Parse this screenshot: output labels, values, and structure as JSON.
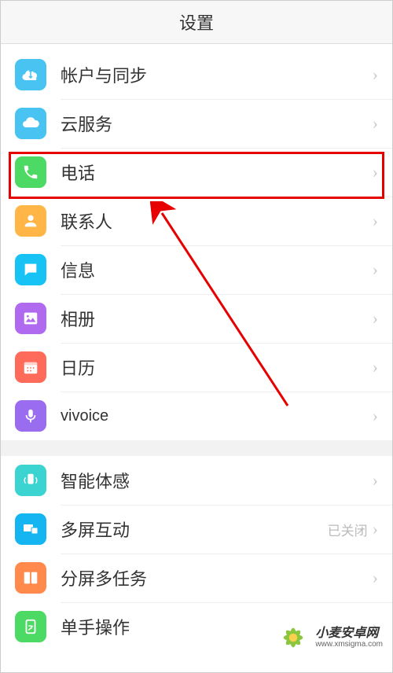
{
  "header": {
    "title": "设置"
  },
  "groups": [
    {
      "items": [
        {
          "icon": "account-sync",
          "label": "帐户与同步"
        },
        {
          "icon": "cloud",
          "label": "云服务"
        },
        {
          "icon": "phone",
          "label": "电话",
          "highlight": true
        },
        {
          "icon": "contacts",
          "label": "联系人"
        },
        {
          "icon": "message",
          "label": "信息"
        },
        {
          "icon": "photos",
          "label": "相册"
        },
        {
          "icon": "calendar",
          "label": "日历"
        },
        {
          "icon": "mic",
          "label": "vivoice"
        }
      ]
    },
    {
      "items": [
        {
          "icon": "motion",
          "label": "智能体感"
        },
        {
          "icon": "multiscreen",
          "label": "多屏互动",
          "value": "已关闭"
        },
        {
          "icon": "splitscreen",
          "label": "分屏多任务"
        },
        {
          "icon": "onehand",
          "label": "单手操作"
        }
      ]
    }
  ],
  "watermark": {
    "title": "小麦安卓网",
    "url": "www.xmsigma.com"
  }
}
